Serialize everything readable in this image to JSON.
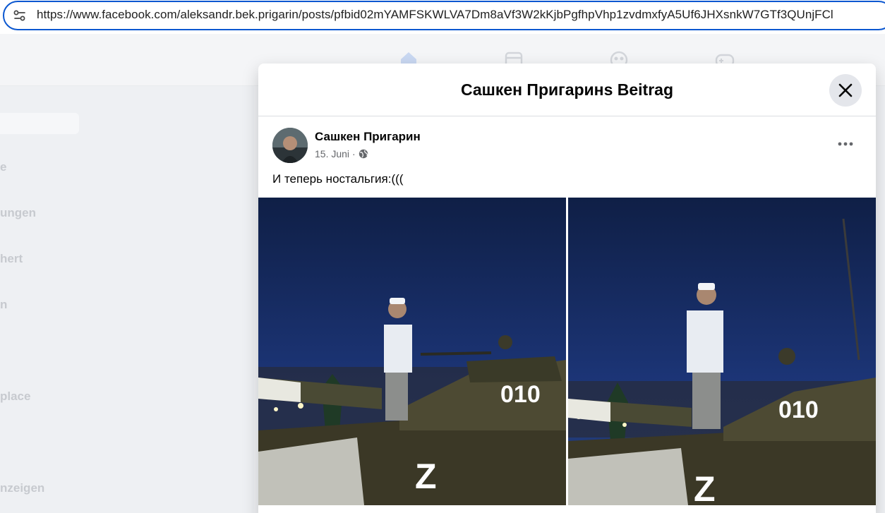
{
  "browser": {
    "url": "https://www.facebook.com/aleksandr.bek.prigarin/posts/pfbid02mYAMFSKWLVA7Dm8aVf3W2kKjbPgfhpVhp1zvdmxfyA5Uf6JHXsnkW7GTf3QUnjFCl",
    "site_info_icon": "tune-icon",
    "accent": "#0b57d0"
  },
  "sidebar": {
    "items": [
      "e",
      "ungen",
      "hert",
      "n",
      "place",
      "nzeigen"
    ]
  },
  "nav_icons": [
    "home-icon",
    "marketplace-icon",
    "groups-icon",
    "gaming-icon"
  ],
  "modal": {
    "title": "Сашкен Пригаринs Beitrag",
    "close_icon": "close-icon"
  },
  "post": {
    "author": "Сашкен Пригарин",
    "date": "15. Juni",
    "separator": "·",
    "audience_icon": "globe-icon",
    "text": "И теперь ностальгия:(((",
    "more_icon": "more-horizontal-icon",
    "photos": [
      {
        "tank_number": "010",
        "mark": "Z"
      },
      {
        "tank_number": "010",
        "mark": "Z"
      }
    ]
  },
  "colors": {
    "page_bg": "#f0f2f5",
    "text_primary": "#050505",
    "text_secondary": "#65676b"
  }
}
